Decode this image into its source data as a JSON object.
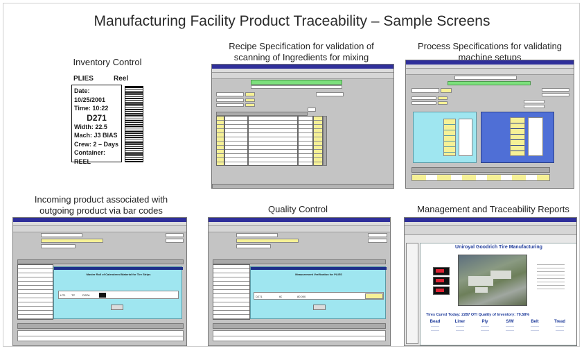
{
  "page": {
    "title": "Manufacturing Facility Product Traceability – Sample Screens"
  },
  "panels": {
    "inventory": {
      "caption": "Inventory Control",
      "label": {
        "plies": "PLIES",
        "reel": "Reel",
        "date": "Date: 10/25/2001",
        "time": "Time: 10:22",
        "code": "D271",
        "width": "Width: 22.5",
        "mach": "Mach: J3 BIAS",
        "crew": "Crew: 2 – Days",
        "container": "Container: REEL"
      }
    },
    "recipe": {
      "caption_line1": "Recipe Specification for validation of",
      "caption_line2": "scanning of Ingredients for mixing"
    },
    "process": {
      "caption_line1": "Process Specifications for validating",
      "caption_line2": "machine setups"
    },
    "incoming": {
      "caption_line1": "Incoming product associated with",
      "caption_line2": "outgoing product via bar codes",
      "popup_title": "Master Roll of Calendered Material for Tire Strips",
      "row_values": [
        "HT1",
        "TP",
        "DSPA"
      ]
    },
    "quality": {
      "caption": "Quality Control",
      "popup_title": "Measurement Verification for PLIES",
      "row_values": [
        "D271",
        "60",
        "80.000"
      ]
    },
    "reports": {
      "caption": "Management and Traceability Reports",
      "report_title": "Uniroyal Goodrich Tire Manufacturing",
      "stats": "Tires Cured Today:   2287   OTI Quality of Inventory:   79.58%",
      "columns": [
        "Bead",
        "Liner",
        "Ply",
        "S/W",
        "Belt",
        "Tread"
      ]
    }
  },
  "colors": {
    "window_title_bar": "#2f2f9a",
    "app_background": "#c4c4c4",
    "input_yellow": "#f6f196",
    "header_green": "#7de07d",
    "panel_cyan": "#9fe6f0",
    "report_blue": "#1d3a9a"
  }
}
